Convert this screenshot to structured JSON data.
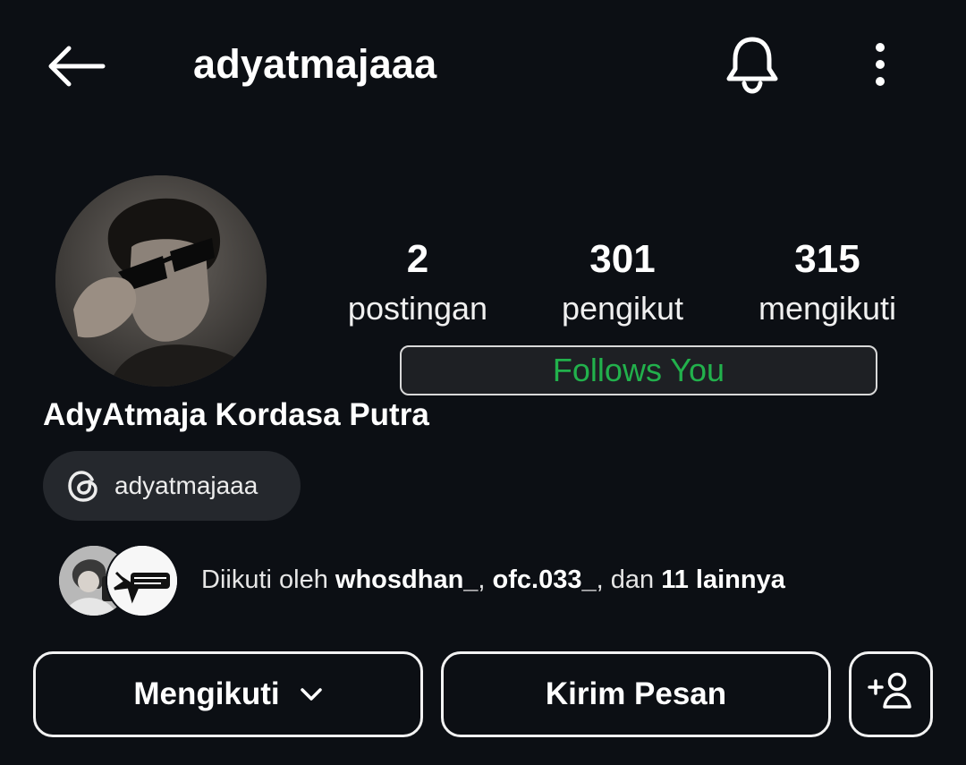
{
  "header": {
    "username": "adyatmajaaa",
    "back_icon": "arrow-left-icon",
    "bell_icon": "bell-icon",
    "more_icon": "more-vertical-icon"
  },
  "profile": {
    "stats": [
      {
        "value": "2",
        "label": "postingan"
      },
      {
        "value": "301",
        "label": "pengikut"
      },
      {
        "value": "315",
        "label": "mengikuti"
      }
    ],
    "follows_you": "Follows You",
    "full_name": "AdyAtmaja Kordasa Putra",
    "threads_handle": "adyatmajaaa"
  },
  "followed_by": {
    "prefix": "Diikuti oleh",
    "user1": "whosdhan_",
    "sep1": ",",
    "user2": "ofc.033_",
    "sep2": ", dan",
    "others": "11 lainnya"
  },
  "actions": {
    "following_label": "Mengikuti",
    "message_label": "Kirim Pesan",
    "suggest_icon": "add-person-icon"
  },
  "colors": {
    "background": "#0c0f14",
    "follows_you_text": "#22b14c",
    "chip_background": "#25282d"
  }
}
